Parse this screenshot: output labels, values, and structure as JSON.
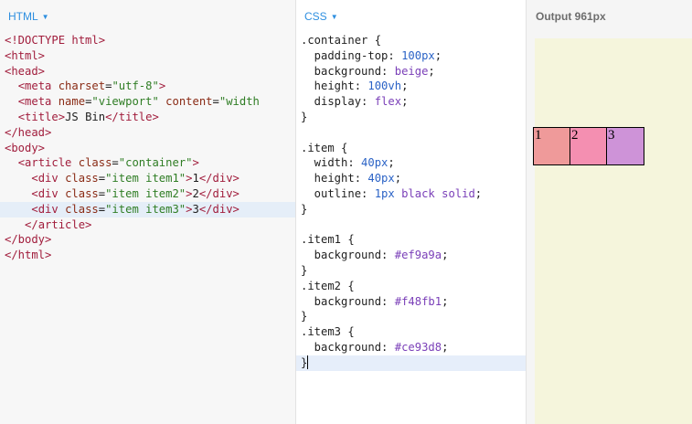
{
  "html_panel": {
    "label": "HTML",
    "lines": [
      [
        {
          "c": "t",
          "t": "<!DOCTYPE html>"
        }
      ],
      [
        {
          "c": "t",
          "t": "<html>"
        }
      ],
      [
        {
          "c": "t",
          "t": "<head>"
        }
      ],
      [
        {
          "c": "p",
          "t": "  "
        },
        {
          "c": "t",
          "t": "<meta"
        },
        {
          "c": "p",
          "t": " "
        },
        {
          "c": "a",
          "t": "charset"
        },
        {
          "c": "p",
          "t": "="
        },
        {
          "c": "v",
          "t": "\"utf-8\""
        },
        {
          "c": "t",
          "t": ">"
        }
      ],
      [
        {
          "c": "p",
          "t": "  "
        },
        {
          "c": "t",
          "t": "<meta"
        },
        {
          "c": "p",
          "t": " "
        },
        {
          "c": "a",
          "t": "name"
        },
        {
          "c": "p",
          "t": "="
        },
        {
          "c": "v",
          "t": "\"viewport\""
        },
        {
          "c": "p",
          "t": " "
        },
        {
          "c": "a",
          "t": "content"
        },
        {
          "c": "p",
          "t": "="
        },
        {
          "c": "v",
          "t": "\"width"
        }
      ],
      [
        {
          "c": "p",
          "t": "  "
        },
        {
          "c": "t",
          "t": "<title>"
        },
        {
          "c": "p",
          "t": "JS Bin"
        },
        {
          "c": "t",
          "t": "</title>"
        }
      ],
      [
        {
          "c": "t",
          "t": "</head>"
        }
      ],
      [
        {
          "c": "t",
          "t": "<body>"
        }
      ],
      [
        {
          "c": "p",
          "t": "  "
        },
        {
          "c": "t",
          "t": "<article"
        },
        {
          "c": "p",
          "t": " "
        },
        {
          "c": "a",
          "t": "class"
        },
        {
          "c": "p",
          "t": "="
        },
        {
          "c": "v",
          "t": "\"container\""
        },
        {
          "c": "t",
          "t": ">"
        }
      ],
      [
        {
          "c": "p",
          "t": "    "
        },
        {
          "c": "t",
          "t": "<div"
        },
        {
          "c": "p",
          "t": " "
        },
        {
          "c": "a",
          "t": "class"
        },
        {
          "c": "p",
          "t": "="
        },
        {
          "c": "v",
          "t": "\"item item1\""
        },
        {
          "c": "t",
          "t": ">"
        },
        {
          "c": "p",
          "t": "1"
        },
        {
          "c": "t",
          "t": "</div>"
        }
      ],
      [
        {
          "c": "p",
          "t": "    "
        },
        {
          "c": "t",
          "t": "<div"
        },
        {
          "c": "p",
          "t": " "
        },
        {
          "c": "a",
          "t": "class"
        },
        {
          "c": "p",
          "t": "="
        },
        {
          "c": "v",
          "t": "\"item item2\""
        },
        {
          "c": "t",
          "t": ">"
        },
        {
          "c": "p",
          "t": "2"
        },
        {
          "c": "t",
          "t": "</div>"
        }
      ],
      [
        {
          "c": "p",
          "t": "    "
        },
        {
          "c": "t",
          "t": "<div"
        },
        {
          "c": "p",
          "t": " "
        },
        {
          "c": "a",
          "t": "class"
        },
        {
          "c": "p",
          "t": "="
        },
        {
          "c": "v",
          "t": "\"item item3\""
        },
        {
          "c": "t",
          "t": ">"
        },
        {
          "c": "p",
          "t": "3"
        },
        {
          "c": "t",
          "t": "</div>"
        }
      ],
      [
        {
          "c": "p",
          "t": "   "
        },
        {
          "c": "t",
          "t": "</article>"
        }
      ],
      [
        {
          "c": "t",
          "t": "</body>"
        }
      ],
      [
        {
          "c": "t",
          "t": "</html>"
        }
      ]
    ],
    "active_line": 11
  },
  "css_panel": {
    "label": "CSS",
    "lines": [
      [
        {
          "c": "p",
          "t": ".container {"
        }
      ],
      [
        {
          "c": "p",
          "t": "  padding-top: "
        },
        {
          "c": "n",
          "t": "100px"
        },
        {
          "c": "p",
          "t": ";"
        }
      ],
      [
        {
          "c": "p",
          "t": "  background: "
        },
        {
          "c": "k",
          "t": "beige"
        },
        {
          "c": "p",
          "t": ";"
        }
      ],
      [
        {
          "c": "p",
          "t": "  height: "
        },
        {
          "c": "n",
          "t": "100vh"
        },
        {
          "c": "p",
          "t": ";"
        }
      ],
      [
        {
          "c": "p",
          "t": "  display: "
        },
        {
          "c": "k",
          "t": "flex"
        },
        {
          "c": "p",
          "t": ";"
        }
      ],
      [
        {
          "c": "p",
          "t": "}"
        }
      ],
      [
        {
          "c": "p",
          "t": ""
        }
      ],
      [
        {
          "c": "p",
          "t": ".item {"
        }
      ],
      [
        {
          "c": "p",
          "t": "  width: "
        },
        {
          "c": "n",
          "t": "40px"
        },
        {
          "c": "p",
          "t": ";"
        }
      ],
      [
        {
          "c": "p",
          "t": "  height: "
        },
        {
          "c": "n",
          "t": "40px"
        },
        {
          "c": "p",
          "t": ";"
        }
      ],
      [
        {
          "c": "p",
          "t": "  outline: "
        },
        {
          "c": "n",
          "t": "1px"
        },
        {
          "c": "p",
          "t": " "
        },
        {
          "c": "k",
          "t": "black"
        },
        {
          "c": "p",
          "t": " "
        },
        {
          "c": "k",
          "t": "solid"
        },
        {
          "c": "p",
          "t": ";"
        }
      ],
      [
        {
          "c": "p",
          "t": "}"
        }
      ],
      [
        {
          "c": "p",
          "t": ""
        }
      ],
      [
        {
          "c": "p",
          "t": ".item1 {"
        }
      ],
      [
        {
          "c": "p",
          "t": "  background: "
        },
        {
          "c": "k",
          "t": "#ef9a9a"
        },
        {
          "c": "p",
          "t": ";"
        }
      ],
      [
        {
          "c": "p",
          "t": "}"
        }
      ],
      [
        {
          "c": "p",
          "t": ".item2 {"
        }
      ],
      [
        {
          "c": "p",
          "t": "  background: "
        },
        {
          "c": "k",
          "t": "#f48fb1"
        },
        {
          "c": "p",
          "t": ";"
        }
      ],
      [
        {
          "c": "p",
          "t": "}"
        }
      ],
      [
        {
          "c": "p",
          "t": ".item3 {"
        }
      ],
      [
        {
          "c": "p",
          "t": "  background: "
        },
        {
          "c": "k",
          "t": "#ce93d8"
        },
        {
          "c": "p",
          "t": ";"
        }
      ],
      [
        {
          "c": "p",
          "t": "}"
        }
      ]
    ],
    "active_line": 21
  },
  "output_panel": {
    "label": "Output 961px",
    "items": [
      {
        "text": "1",
        "color": "#ef9a9a"
      },
      {
        "text": "2",
        "color": "#f48fb1"
      },
      {
        "text": "3",
        "color": "#ce93d8"
      }
    ]
  },
  "icons": {
    "dropdown": "caret-down-icon"
  }
}
